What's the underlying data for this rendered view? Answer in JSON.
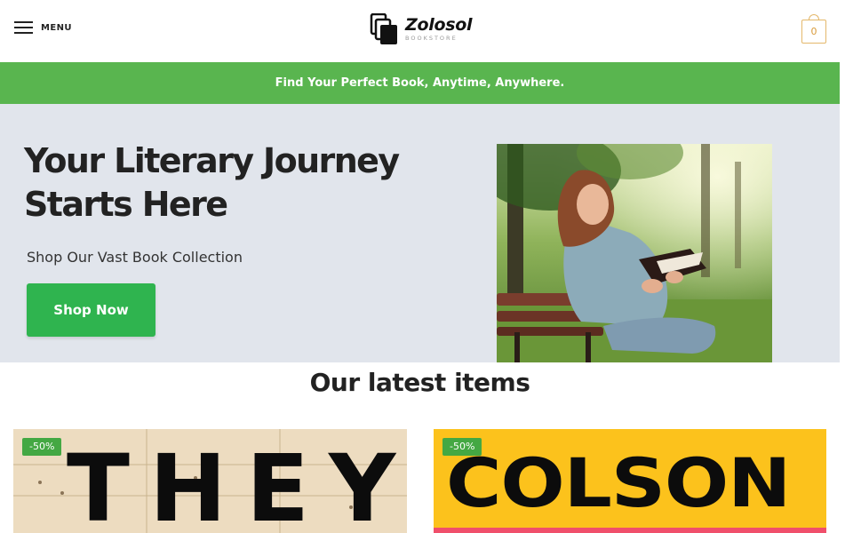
{
  "header": {
    "menu_label": "MENU",
    "logo_name": "Zolosol",
    "logo_sub": "BOOKSTORE",
    "cart_count": "0"
  },
  "promo": {
    "text": "Find Your Perfect Book, Anytime, Anywhere."
  },
  "hero": {
    "title_line1": "Your Literary Journey",
    "title_line2": "Starts Here",
    "subtitle": "Shop Our Vast Book Collection",
    "button_label": "Shop Now"
  },
  "latest": {
    "title": "Our latest items",
    "products": [
      {
        "badge": "-50%",
        "cover_text": "THEY"
      },
      {
        "badge": "-50%",
        "cover_text": "COLSON"
      }
    ]
  },
  "colors": {
    "promo_bg": "#59b54f",
    "button_bg": "#2fb44f",
    "badge_bg": "#44a843",
    "hero_bg": "#e1e5ec",
    "cart_accent": "#e4b86b"
  }
}
